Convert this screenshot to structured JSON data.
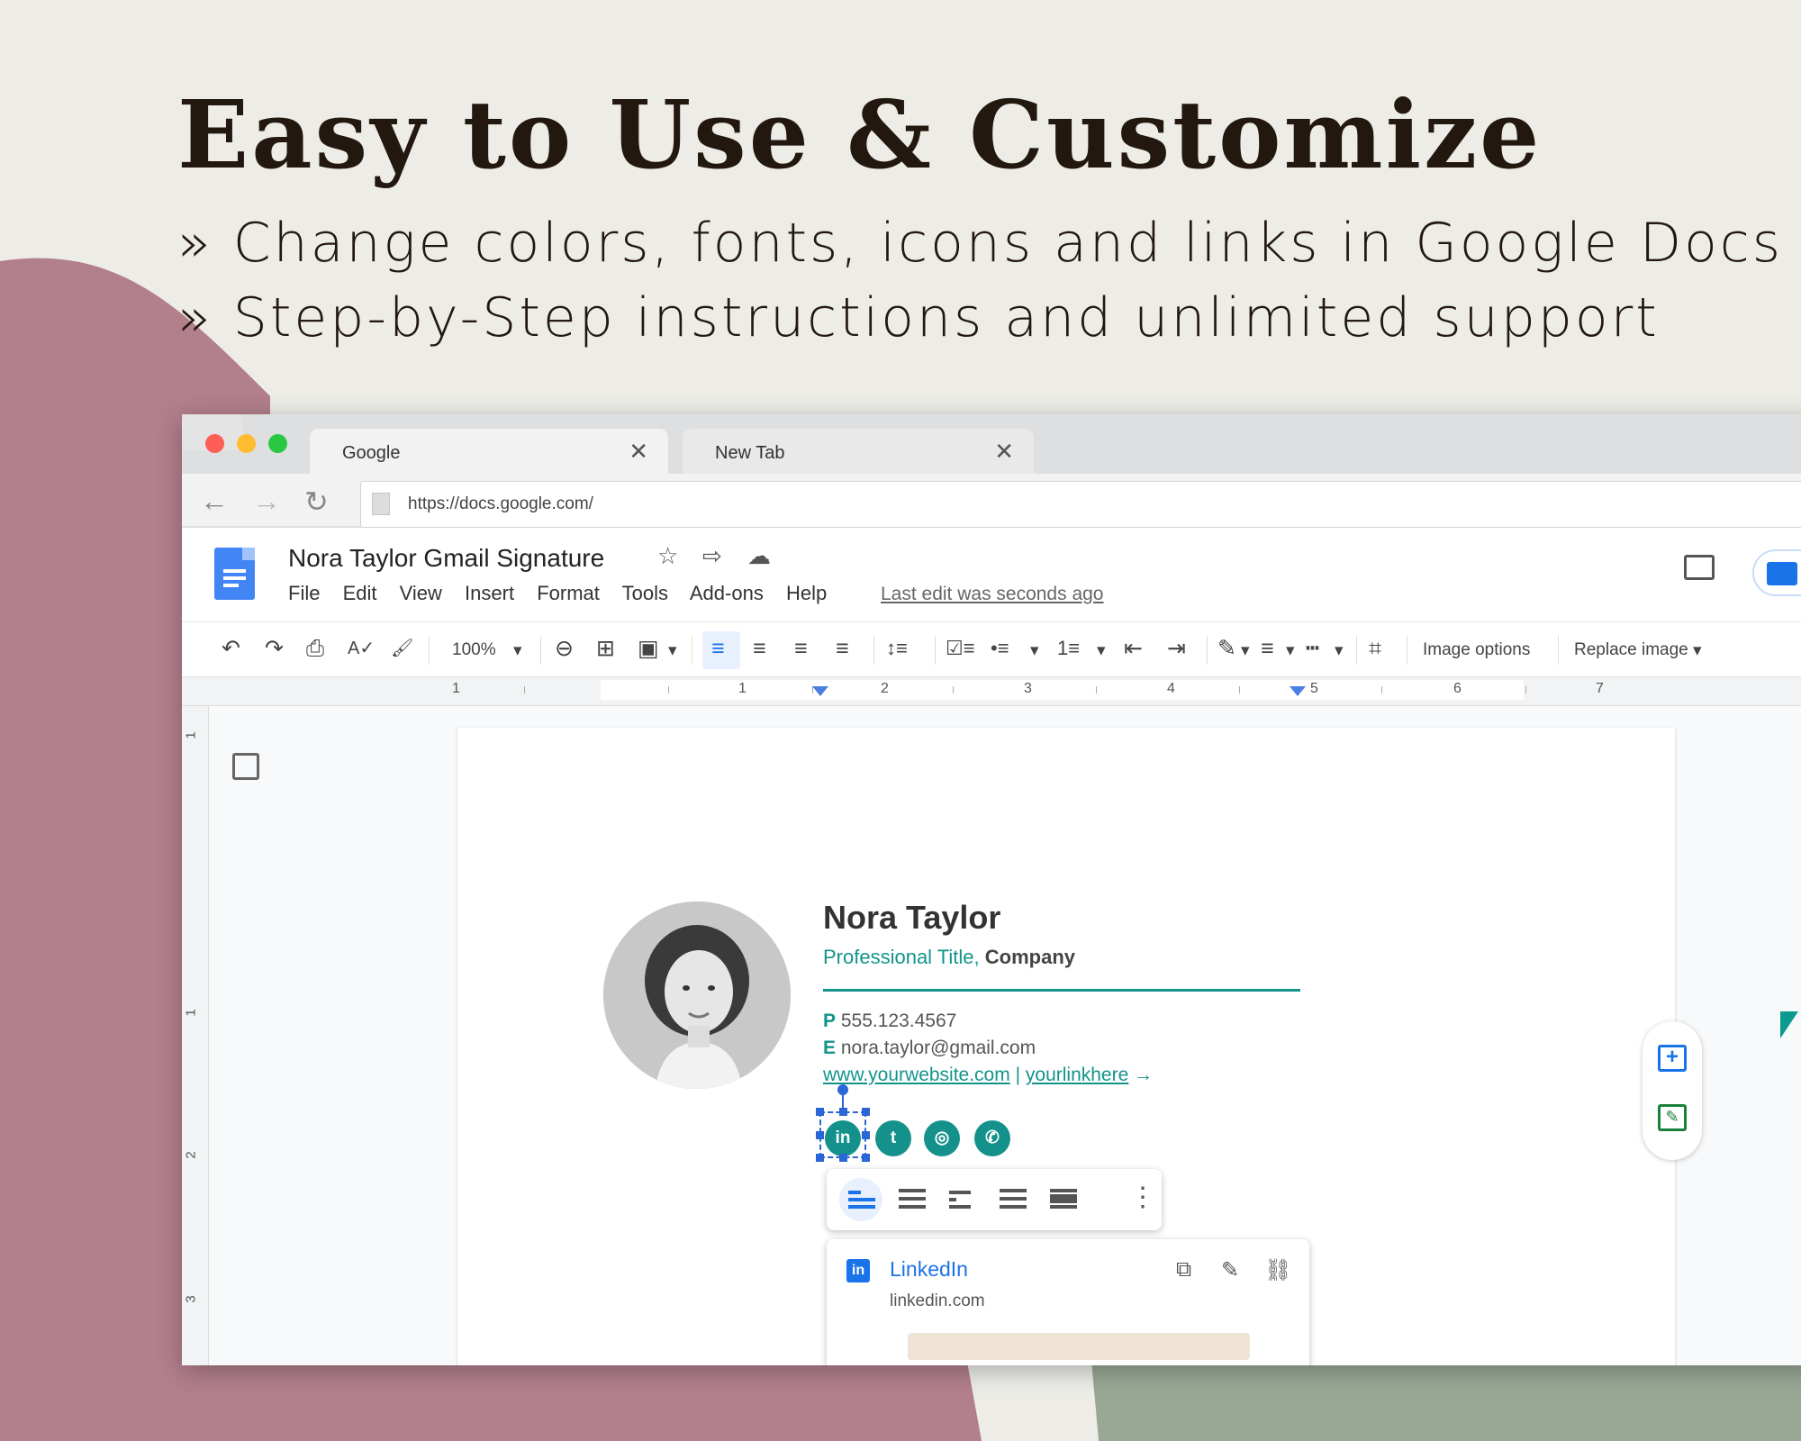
{
  "hero": {
    "headline": "Easy to Use & Customize",
    "bullets": [
      "» Change colors, fonts, icons and links in Google Docs",
      "» Step-by-Step instructions and unlimited support"
    ]
  },
  "browser": {
    "tabs": [
      {
        "label": "Google",
        "close": "✕"
      },
      {
        "label": "New Tab",
        "close": "✕"
      }
    ],
    "nav": {
      "back": "←",
      "forward": "→",
      "reload": "↻"
    },
    "url": "https://docs.google.com/"
  },
  "docs": {
    "title": "Nora Taylor Gmail Signature",
    "header_icons": {
      "star": "☆",
      "move": "⇨",
      "cloud": "☁"
    },
    "menu": [
      "File",
      "Edit",
      "View",
      "Insert",
      "Format",
      "Tools",
      "Add-ons",
      "Help"
    ],
    "last_edit": "Last edit was seconds ago",
    "toolbar": {
      "undo": "↶",
      "redo": "↷",
      "print": "⎙",
      "spell": "A✓",
      "paint": "🖌",
      "zoom": "100%",
      "link": "⊖",
      "comment": "⊞",
      "image": "▣",
      "align_left": "≡",
      "align_center": "≡",
      "align_right": "≡",
      "justify": "≡",
      "line_spacing": "↕≡",
      "checklist": "☑≡",
      "bullets": "•≡",
      "numbered": "1≡",
      "outdent": "⇤",
      "indent": "⇥",
      "pen": "✎",
      "border_weight": "≡",
      "border_dash": "┅",
      "crop": "⌗",
      "image_options": "Image options",
      "replace_image": "Replace image",
      "dropdown": "▾"
    },
    "ruler_numbers": [
      "1",
      "1",
      "2",
      "3",
      "4",
      "5",
      "6",
      "7"
    ],
    "vruler_numbers": [
      "1",
      "1",
      "2",
      "3"
    ]
  },
  "signature": {
    "name": "Nora Taylor",
    "title": "Professional Title,",
    "company": "Company",
    "phone_label": "P",
    "phone": "555.123.4567",
    "email_label": "E",
    "email": "nora.taylor@gmail.com",
    "website": "www.yourwebsite.com",
    "separator": "|",
    "link": "yourlinkhere",
    "link_arrow": "→",
    "social": [
      {
        "name": "linkedin",
        "glyph": "in"
      },
      {
        "name": "twitter",
        "glyph": "t"
      },
      {
        "name": "instagram",
        "glyph": "◎"
      },
      {
        "name": "whatsapp",
        "glyph": "✆"
      }
    ]
  },
  "link_card": {
    "icon": "in",
    "title": "LinkedIn",
    "url": "linkedin.com",
    "actions": {
      "copy": "⧉",
      "edit": "✎",
      "unlink": "⛓"
    }
  },
  "wrap_menu": {
    "more": "⋮"
  },
  "side_fab": {
    "add": "+",
    "suggest": "✎"
  },
  "colors": {
    "accent": "#13948b",
    "mauve": "#b27f8c",
    "sage": "#99a795",
    "docs_blue": "#4285f4",
    "headline": "#23180f"
  }
}
